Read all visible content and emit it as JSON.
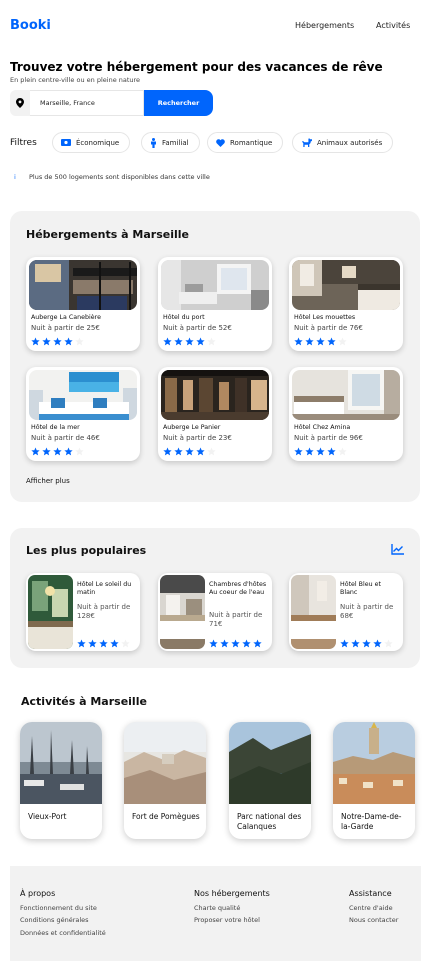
{
  "header": {
    "logo": "Booki",
    "nav": [
      "Hébergements",
      "Activités"
    ]
  },
  "hero": {
    "title": "Trouvez votre hébergement pour des vacances de rêve",
    "subtitle": "En plein centre-ville ou en pleine nature"
  },
  "search": {
    "value": "Marseille, France",
    "button_label": "Rechercher"
  },
  "filters": {
    "label": "Filtres",
    "chips": [
      {
        "label": "Économique",
        "icon": "money-icon"
      },
      {
        "label": "Familial",
        "icon": "child-icon"
      },
      {
        "label": "Romantique",
        "icon": "heart-icon"
      },
      {
        "label": "Animaux autorisés",
        "icon": "dog-icon"
      }
    ]
  },
  "info": {
    "text": "Plus de 500 logements sont disponibles dans cette ville"
  },
  "accommodations": {
    "title": "Hébergements à Marseille",
    "show_more": "Afficher plus",
    "items": [
      {
        "name": "Auberge La Canebière",
        "price": "Nuit à partir de 25€",
        "rating": 4
      },
      {
        "name": "Hôtel du port",
        "price": "Nuit à partir de 52€",
        "rating": 4
      },
      {
        "name": "Hôtel Les mouettes",
        "price": "Nuit à partir de 76€",
        "rating": 4
      },
      {
        "name": "Hôtel de la mer",
        "price": "Nuit à partir de 46€",
        "rating": 4
      },
      {
        "name": "Auberge Le Panier",
        "price": "Nuit à partir de 23€",
        "rating": 4
      },
      {
        "name": "Hôtel Chez Amina",
        "price": "Nuit à partir de 96€",
        "rating": 4
      }
    ]
  },
  "popular": {
    "title": "Les plus populaires",
    "icon": "trend-chart-icon",
    "items": [
      {
        "name": "Hôtel Le soleil du matin",
        "price": "Nuit à partir de 128€",
        "rating": 4
      },
      {
        "name": "Chambres d'hôtes Au coeur de l'eau",
        "price": "Nuit à partir de 71€",
        "rating": 5
      },
      {
        "name": "Hôtel Bleu et Blanc",
        "price": "Nuit à partir de 68€",
        "rating": 4
      }
    ]
  },
  "activities": {
    "title": "Activités à Marseille",
    "items": [
      {
        "label": "Vieux-Port"
      },
      {
        "label": "Fort de Pomègues"
      },
      {
        "label": "Parc national des Calanques"
      },
      {
        "label": "Notre-Dame-de-la-Garde"
      }
    ]
  },
  "footer": {
    "columns": [
      {
        "title": "À propos",
        "links": [
          "Fonctionnement du site",
          "Conditions générales",
          "Données et confidentialité"
        ]
      },
      {
        "title": "Nos hébergements",
        "links": [
          "Charte qualité",
          "Proposer votre hôtel"
        ]
      },
      {
        "title": "Assistance",
        "links": [
          "Centre d'aide",
          "Nous contacter"
        ]
      }
    ]
  },
  "colors": {
    "brand": "#0065FC",
    "panel": "#F2F2F2",
    "star_on": "#0065FC",
    "star_off": "#F2F2F2"
  }
}
